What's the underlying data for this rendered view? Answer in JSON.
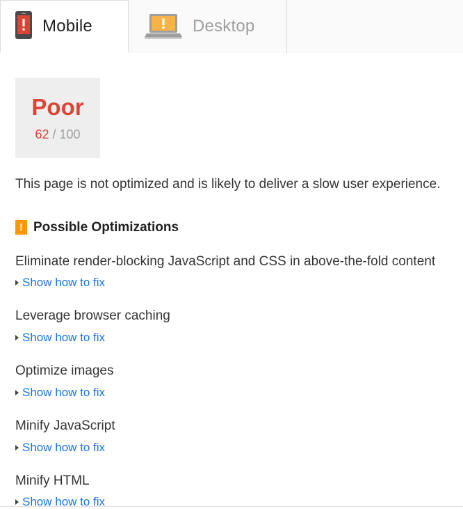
{
  "tabs": [
    {
      "label": "Mobile",
      "icon": "mobile-warning-icon",
      "active": true,
      "status_color": "#db4437"
    },
    {
      "label": "Desktop",
      "icon": "desktop-warning-icon",
      "active": false,
      "status_color": "#f5b445"
    }
  ],
  "score": {
    "rating": "Poor",
    "value": "62",
    "total": "/ 100",
    "rating_color": "#db4437",
    "card_background": "#eeeeee"
  },
  "summary": "This page is not optimized and is likely to deliver a slow user experience.",
  "section": {
    "icon": "warning-badge-icon",
    "badge_glyph": "!",
    "badge_color": "#ff9800",
    "title": "Possible Optimizations"
  },
  "rules": [
    {
      "title": "Eliminate render-blocking JavaScript and CSS in above-the-fold content",
      "link": "Show how to fix"
    },
    {
      "title": "Leverage browser caching",
      "link": "Show how to fix"
    },
    {
      "title": "Optimize images",
      "link": "Show how to fix"
    },
    {
      "title": "Minify JavaScript",
      "link": "Show how to fix"
    },
    {
      "title": "Minify HTML",
      "link": "Show how to fix"
    }
  ],
  "link_color": "#1a73e8"
}
